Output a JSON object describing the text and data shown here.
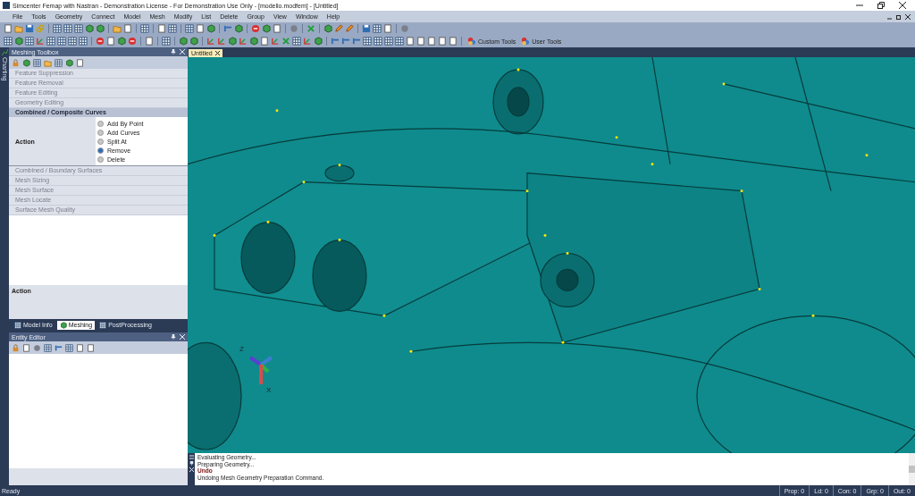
{
  "window": {
    "title": "Simcenter Femap with Nastran - Demonstration License - For Demonstration Use Only - [modello.modfem] - [Untitled]"
  },
  "menu": [
    "File",
    "Tools",
    "Geometry",
    "Connect",
    "Model",
    "Mesh",
    "Modify",
    "List",
    "Delete",
    "Group",
    "View",
    "Window",
    "Help"
  ],
  "toolbar_tools": [
    {
      "label": "Custom Tools"
    },
    {
      "label": "User Tools"
    }
  ],
  "side_strip": {
    "label": "Charting"
  },
  "meshing_toolbox": {
    "title": "Meshing Toolbox",
    "sections_before": [
      "Feature Suppression",
      "Feature Removal",
      "Feature Editing",
      "Geometry Editing"
    ],
    "active_section": {
      "title": "Combined / Composite Curves",
      "field_label": "Action",
      "options": [
        {
          "label": "Add By Point",
          "selected": false
        },
        {
          "label": "Add Curves",
          "selected": false
        },
        {
          "label": "Split At",
          "selected": false
        },
        {
          "label": "Remove",
          "selected": true
        },
        {
          "label": "Delete",
          "selected": false
        }
      ]
    },
    "sections_after": [
      "Combined / Boundary Surfaces",
      "Mesh Sizing",
      "Mesh Surface",
      "Mesh Locate",
      "Surface Mesh Quality"
    ],
    "description_title": "Action",
    "tabs": [
      {
        "label": "Model Info",
        "selected": false
      },
      {
        "label": "Meshing",
        "selected": true
      },
      {
        "label": "PostProcessing",
        "selected": false
      }
    ]
  },
  "entity_editor": {
    "title": "Entity Editor"
  },
  "document_tab": {
    "label": "Untitled"
  },
  "viewport": {
    "axis_labels": [
      "Z",
      "X"
    ]
  },
  "messages": [
    {
      "text": "Evaluating Geometry...",
      "kind": "info"
    },
    {
      "text": "Preparing Geometry...",
      "kind": "info"
    },
    {
      "text": "Undo",
      "kind": "command"
    },
    {
      "text": "Undoing Mesh Geometry Preparation Command.",
      "kind": "info"
    }
  ],
  "status_bar": {
    "text": "Ready",
    "counters": [
      "Prop: 0",
      "Ld: 0",
      "Con: 0",
      "Grp: 0",
      "Out: 0"
    ]
  }
}
